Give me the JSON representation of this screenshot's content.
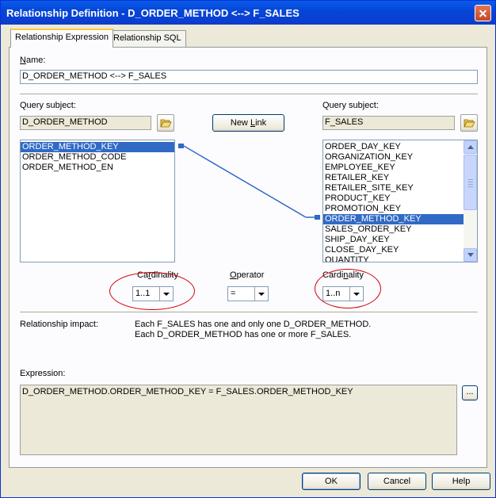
{
  "window": {
    "title": "Relationship Definition - D_ORDER_METHOD <--> F_SALES"
  },
  "tabs": [
    {
      "label": "Relationship Expression"
    },
    {
      "label": "Relationship SQL"
    }
  ],
  "name": {
    "label": "Name:",
    "label_mnemonic": "N",
    "label_rest": "ame:",
    "value": "D_ORDER_METHOD <--> F_SALES"
  },
  "left_query": {
    "label": "Query subject:",
    "value": "D_ORDER_METHOD",
    "items": [
      "ORDER_METHOD_KEY",
      "ORDER_METHOD_CODE",
      "ORDER_METHOD_EN"
    ],
    "selected_index": 0
  },
  "right_query": {
    "label": "Query subject:",
    "value": "F_SALES",
    "items": [
      "ORDER_DAY_KEY",
      "ORGANIZATION_KEY",
      "EMPLOYEE_KEY",
      "RETAILER_KEY",
      "RETAILER_SITE_KEY",
      "PRODUCT_KEY",
      "PROMOTION_KEY",
      "ORDER_METHOD_KEY",
      "SALES_ORDER_KEY",
      "SHIP_DAY_KEY",
      "CLOSE_DAY_KEY",
      "QUANTITY"
    ],
    "selected_index": 7
  },
  "new_link": {
    "pre": "New ",
    "mnemonic": "L",
    "post": "ink"
  },
  "cardinality_left": {
    "pre": "Ca",
    "mnemonic": "r",
    "post": "dinality",
    "value": "1..1"
  },
  "operator": {
    "pre": "",
    "mnemonic": "O",
    "post": "perator",
    "value": "="
  },
  "cardinality_right": {
    "pre": "Cardi",
    "mnemonic": "n",
    "post": "ality",
    "value": "1..n"
  },
  "impact": {
    "label": "Relationship impact:",
    "line1": "Each F_SALES has one and only one D_ORDER_METHOD.",
    "line2": "Each D_ORDER_METHOD has one or more F_SALES."
  },
  "expression": {
    "label": "Expression:",
    "value": "D_ORDER_METHOD.ORDER_METHOD_KEY = F_SALES.ORDER_METHOD_KEY",
    "ellipsis_label": "..."
  },
  "buttons": {
    "ok": "OK",
    "cancel": "Cancel",
    "help": "Help"
  },
  "colors": {
    "selection": "#316ac5",
    "link_line": "#316ac5",
    "annotation": "#d00000"
  },
  "icons": {
    "close": "close-icon",
    "folder_left": "open-folder-icon",
    "folder_right": "open-folder-icon"
  }
}
